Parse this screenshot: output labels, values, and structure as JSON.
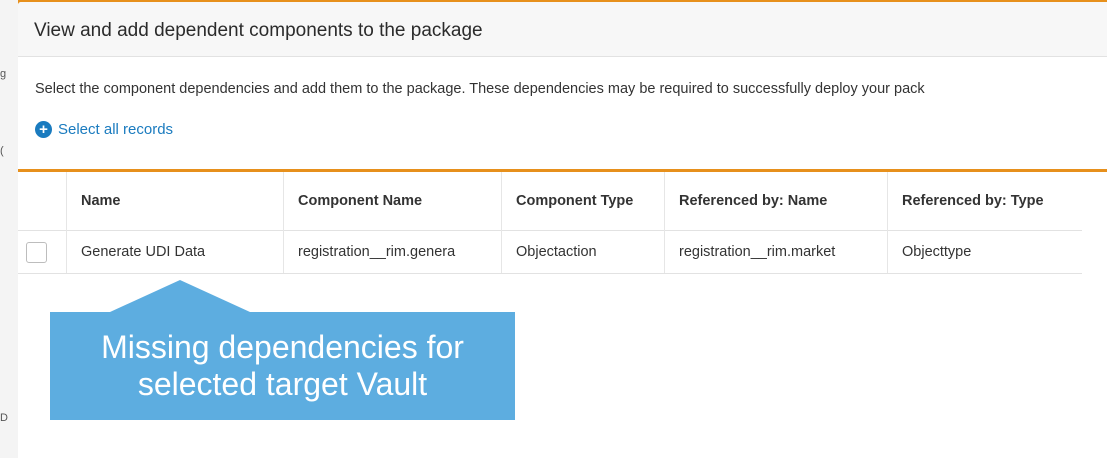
{
  "dialog": {
    "title": "View and add dependent components to the package",
    "description": "Select the component dependencies and add them to the package. These dependencies may be required to successfully deploy your pack",
    "select_all_label": "Select all records",
    "select_all_icon": "plus-circle-icon"
  },
  "table": {
    "columns": [
      "Name",
      "Component Name",
      "Component Type",
      "Referenced by: Name",
      "Referenced by: Type"
    ],
    "rows": [
      [
        "Generate UDI Data",
        "registration__rim.genera",
        "Objectaction",
        "registration__rim.market",
        "Objecttype"
      ]
    ]
  },
  "callout": {
    "line1": "Missing dependencies for",
    "line2": "selected target Vault"
  },
  "colors": {
    "accent": "#e7901c",
    "link": "#1a7bbf",
    "callout": "#5dade0"
  }
}
